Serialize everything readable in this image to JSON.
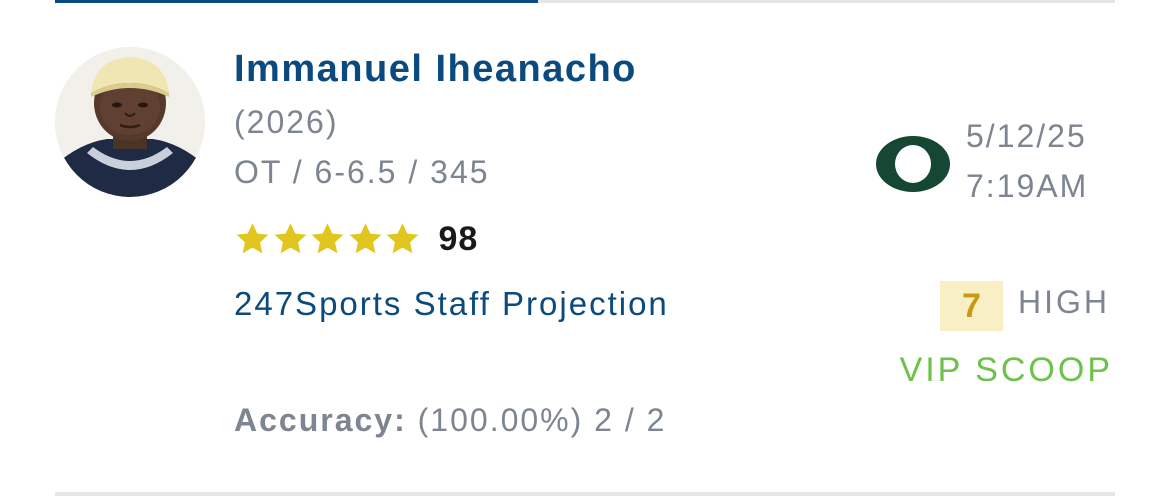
{
  "prediction": {
    "player": {
      "name": "Immanuel Iheanacho",
      "class_year": "(2026)",
      "measurables": "OT / 6-6.5 / 345",
      "stars": 5,
      "rating": "98",
      "avatar_icon": "player-headshot"
    },
    "predictor": {
      "name": "247Sports Staff Projection",
      "accuracy_label": "Accuracy:",
      "accuracy_value": "(100.00%) 2 / 2"
    },
    "team": {
      "logo_icon": "oregon-o-logo",
      "logo_color": "#154733"
    },
    "date": "5/12/25",
    "time": "7:19AM",
    "confidence": {
      "score": "7",
      "level": "HIGH"
    },
    "vip_tag": "VIP SCOOP"
  },
  "colors": {
    "name_blue": "#0b4a7e",
    "muted_gray": "#7c8590",
    "star_yellow": "#e0c61f",
    "confidence_bg": "#f9efc4",
    "confidence_text": "#c79a12",
    "vip_green": "#6cc24a"
  }
}
